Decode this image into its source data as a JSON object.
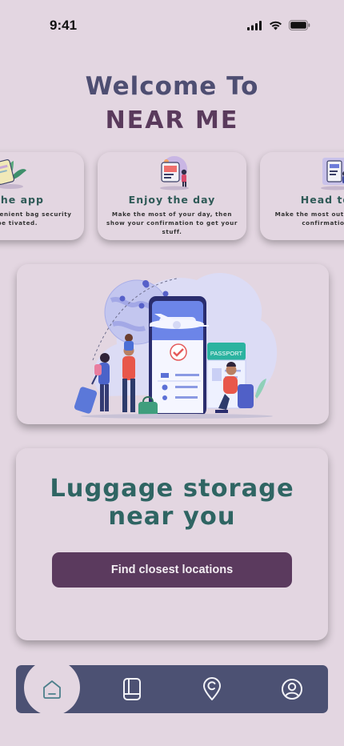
{
  "status_bar": {
    "time": "9:41"
  },
  "header": {
    "line1": "Welcome To",
    "line2": "NEAR ME"
  },
  "cards": [
    {
      "title": "on the app",
      "text": "choose a convenient bag security will be tivated."
    },
    {
      "title": "Enjoy the day",
      "text": "Make the most of your day, then show your confirmation to get your stuff."
    },
    {
      "title": "Head to th",
      "text": "Make the most out of show your confirmatio stuff."
    }
  ],
  "hero": {
    "passport_label": "PASSPORT"
  },
  "luggage": {
    "title": "Luggage storage near you",
    "button_label": "Find closest locations"
  },
  "nav": {
    "items": [
      "home-icon",
      "bookings-icon",
      "location-icon",
      "profile-icon"
    ],
    "active": "home-icon"
  },
  "colors": {
    "background": "#e3d6e1",
    "nav": "#4c5173",
    "button": "#5b3a5e",
    "teal": "#2f6563"
  }
}
